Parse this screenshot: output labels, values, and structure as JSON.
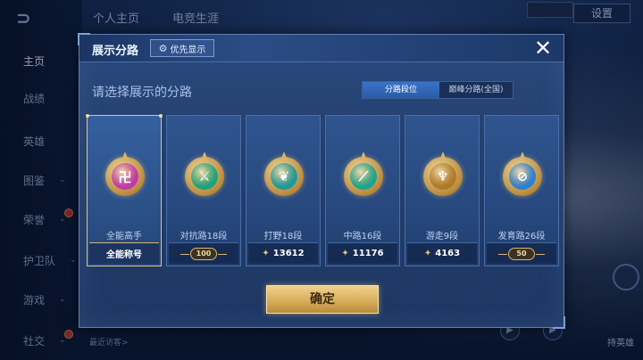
{
  "background": {
    "top_tabs": [
      "个人主页",
      "电竞生涯"
    ],
    "top_right_button": "设置",
    "side_nav": [
      {
        "label": "主页",
        "active": true,
        "chevron": false,
        "dot": false
      },
      {
        "label": "战绩",
        "active": false,
        "chevron": false,
        "dot": false
      },
      {
        "label": "英雄",
        "active": false,
        "chevron": false,
        "dot": false
      },
      {
        "label": "图鉴",
        "active": false,
        "chevron": true,
        "dot": false
      },
      {
        "label": "荣誉",
        "active": false,
        "chevron": true,
        "dot": true
      },
      {
        "label": "护卫队",
        "active": false,
        "chevron": true,
        "dot": false
      },
      {
        "label": "游戏",
        "active": false,
        "chevron": true,
        "dot": false
      },
      {
        "label": "社交",
        "active": false,
        "chevron": true,
        "dot": true
      }
    ],
    "visitors_text": "最近访客>",
    "bottom_right_label": "持英雄"
  },
  "modal": {
    "title": "展示分路",
    "priority_button": "优先显示",
    "prompt": "请选择展示的分路",
    "segments": [
      {
        "label": "分路段位",
        "selected": true
      },
      {
        "label": "巅峰分路(全国)",
        "selected": false
      }
    ],
    "cards": [
      {
        "label": "全能高手",
        "footer_text": "全能称号",
        "badge": "",
        "peak": false,
        "selected": true,
        "emblem_color": "#c23aa8",
        "glyph": "卍"
      },
      {
        "label": "对抗路18段",
        "footer_text": "",
        "badge": "100",
        "peak": false,
        "selected": false,
        "emblem_color": "#1fa37a",
        "glyph": "⚔"
      },
      {
        "label": "打野18段",
        "footer_text": "13612",
        "badge": "",
        "peak": true,
        "selected": false,
        "emblem_color": "#1f9a9a",
        "glyph": "❦"
      },
      {
        "label": "中路16段",
        "footer_text": "11176",
        "badge": "",
        "peak": true,
        "selected": false,
        "emblem_color": "#1ea38c",
        "glyph": "⟋"
      },
      {
        "label": "游走9段",
        "footer_text": "4163",
        "badge": "",
        "peak": true,
        "selected": false,
        "emblem_color": "#b07a2a",
        "glyph": "♆"
      },
      {
        "label": "发育路26段",
        "footer_text": "",
        "badge": "50",
        "peak": false,
        "selected": false,
        "emblem_color": "#2f7fd0",
        "glyph": "⊘"
      }
    ],
    "confirm_button": "确定",
    "close_icon": "close-icon"
  }
}
